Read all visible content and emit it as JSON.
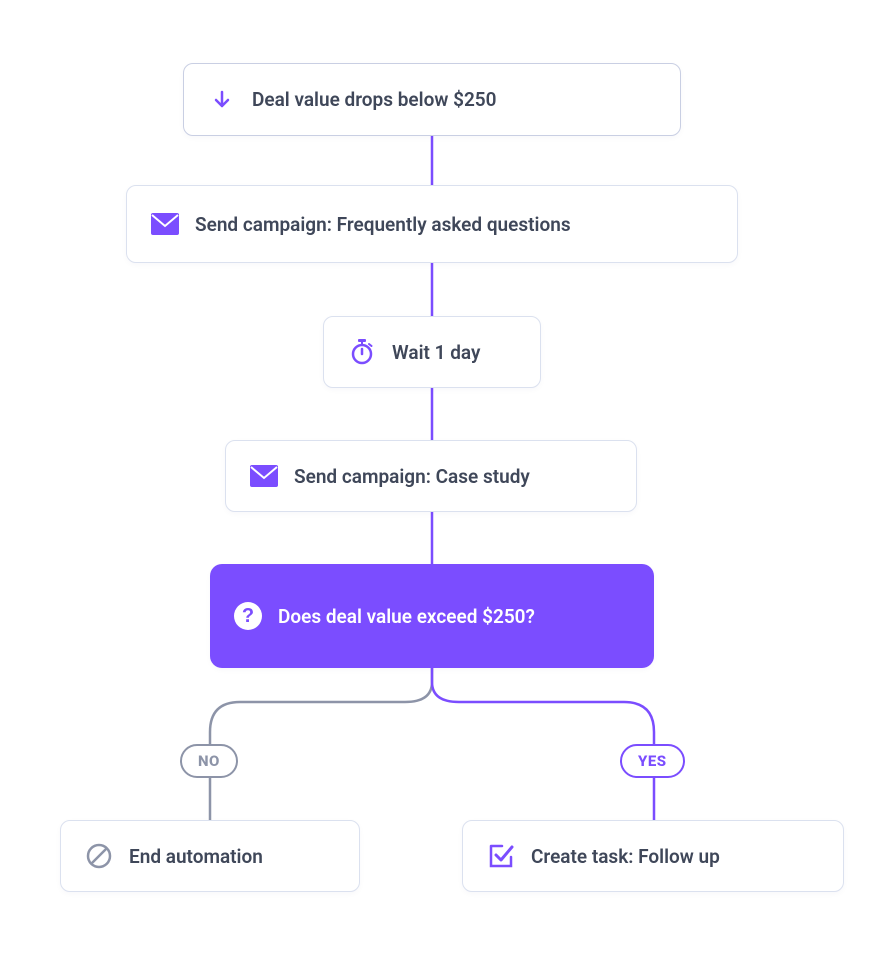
{
  "colors": {
    "accent": "#7B4DFF",
    "muted": "#8d94a8",
    "border": "#dbe1ef",
    "text": "#3f4759"
  },
  "nodes": {
    "trigger": {
      "label": "Deal value drops below $250",
      "icon": "arrow-down"
    },
    "action1": {
      "label": "Send campaign: Frequently asked questions",
      "icon": "mail"
    },
    "wait": {
      "label": "Wait 1 day",
      "icon": "timer"
    },
    "action2": {
      "label": "Send campaign: Case study",
      "icon": "mail"
    },
    "condition": {
      "label": "Does deal value exceed $250?",
      "icon": "question"
    },
    "branch_no": {
      "pill": "NO",
      "label": "End automation",
      "icon": "stop"
    },
    "branch_yes": {
      "pill": "YES",
      "label": "Create task: Follow up",
      "icon": "check-box"
    }
  }
}
